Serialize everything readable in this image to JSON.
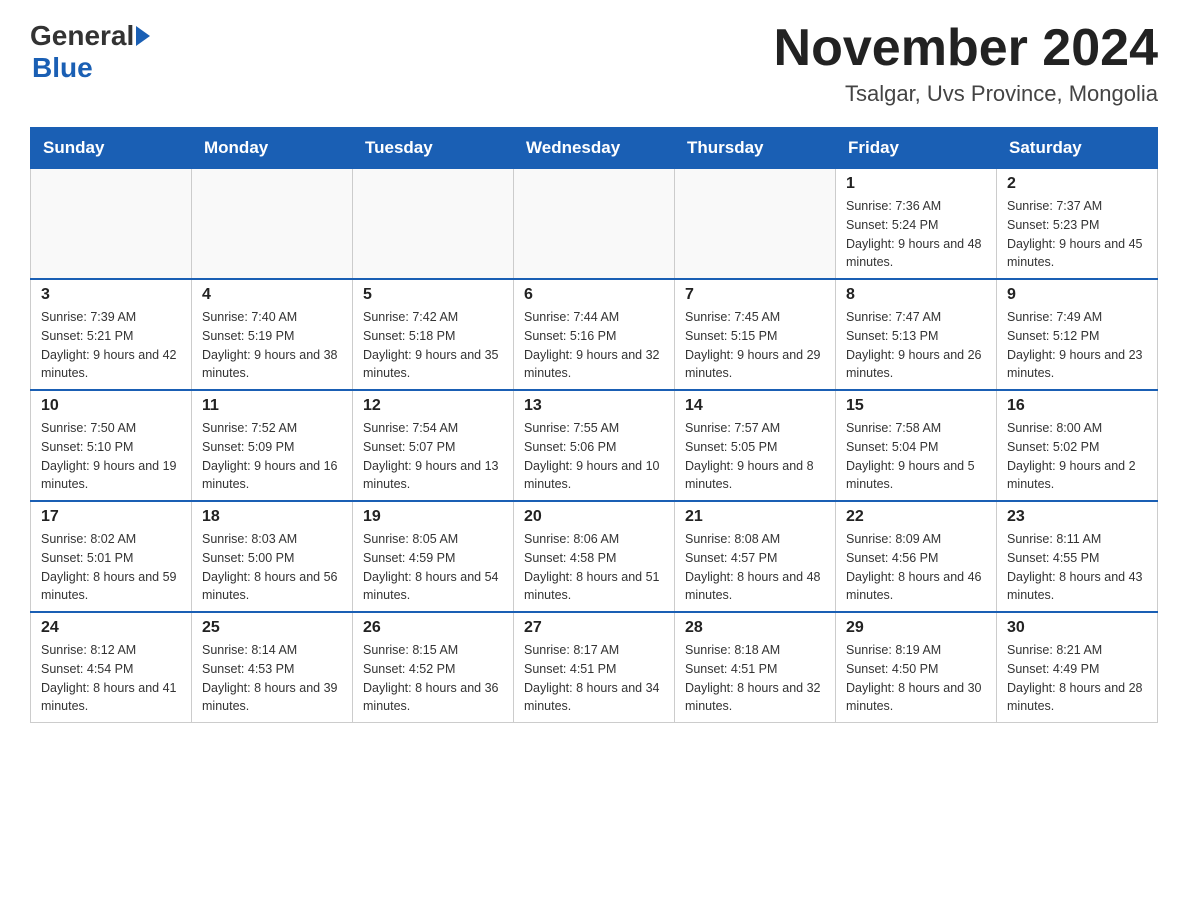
{
  "header": {
    "logo_general": "General",
    "logo_blue": "Blue",
    "month_title": "November 2024",
    "subtitle": "Tsalgar, Uvs Province, Mongolia"
  },
  "days_of_week": [
    "Sunday",
    "Monday",
    "Tuesday",
    "Wednesday",
    "Thursday",
    "Friday",
    "Saturday"
  ],
  "weeks": [
    [
      {
        "day": "",
        "info": ""
      },
      {
        "day": "",
        "info": ""
      },
      {
        "day": "",
        "info": ""
      },
      {
        "day": "",
        "info": ""
      },
      {
        "day": "",
        "info": ""
      },
      {
        "day": "1",
        "info": "Sunrise: 7:36 AM\nSunset: 5:24 PM\nDaylight: 9 hours and 48 minutes."
      },
      {
        "day": "2",
        "info": "Sunrise: 7:37 AM\nSunset: 5:23 PM\nDaylight: 9 hours and 45 minutes."
      }
    ],
    [
      {
        "day": "3",
        "info": "Sunrise: 7:39 AM\nSunset: 5:21 PM\nDaylight: 9 hours and 42 minutes."
      },
      {
        "day": "4",
        "info": "Sunrise: 7:40 AM\nSunset: 5:19 PM\nDaylight: 9 hours and 38 minutes."
      },
      {
        "day": "5",
        "info": "Sunrise: 7:42 AM\nSunset: 5:18 PM\nDaylight: 9 hours and 35 minutes."
      },
      {
        "day": "6",
        "info": "Sunrise: 7:44 AM\nSunset: 5:16 PM\nDaylight: 9 hours and 32 minutes."
      },
      {
        "day": "7",
        "info": "Sunrise: 7:45 AM\nSunset: 5:15 PM\nDaylight: 9 hours and 29 minutes."
      },
      {
        "day": "8",
        "info": "Sunrise: 7:47 AM\nSunset: 5:13 PM\nDaylight: 9 hours and 26 minutes."
      },
      {
        "day": "9",
        "info": "Sunrise: 7:49 AM\nSunset: 5:12 PM\nDaylight: 9 hours and 23 minutes."
      }
    ],
    [
      {
        "day": "10",
        "info": "Sunrise: 7:50 AM\nSunset: 5:10 PM\nDaylight: 9 hours and 19 minutes."
      },
      {
        "day": "11",
        "info": "Sunrise: 7:52 AM\nSunset: 5:09 PM\nDaylight: 9 hours and 16 minutes."
      },
      {
        "day": "12",
        "info": "Sunrise: 7:54 AM\nSunset: 5:07 PM\nDaylight: 9 hours and 13 minutes."
      },
      {
        "day": "13",
        "info": "Sunrise: 7:55 AM\nSunset: 5:06 PM\nDaylight: 9 hours and 10 minutes."
      },
      {
        "day": "14",
        "info": "Sunrise: 7:57 AM\nSunset: 5:05 PM\nDaylight: 9 hours and 8 minutes."
      },
      {
        "day": "15",
        "info": "Sunrise: 7:58 AM\nSunset: 5:04 PM\nDaylight: 9 hours and 5 minutes."
      },
      {
        "day": "16",
        "info": "Sunrise: 8:00 AM\nSunset: 5:02 PM\nDaylight: 9 hours and 2 minutes."
      }
    ],
    [
      {
        "day": "17",
        "info": "Sunrise: 8:02 AM\nSunset: 5:01 PM\nDaylight: 8 hours and 59 minutes."
      },
      {
        "day": "18",
        "info": "Sunrise: 8:03 AM\nSunset: 5:00 PM\nDaylight: 8 hours and 56 minutes."
      },
      {
        "day": "19",
        "info": "Sunrise: 8:05 AM\nSunset: 4:59 PM\nDaylight: 8 hours and 54 minutes."
      },
      {
        "day": "20",
        "info": "Sunrise: 8:06 AM\nSunset: 4:58 PM\nDaylight: 8 hours and 51 minutes."
      },
      {
        "day": "21",
        "info": "Sunrise: 8:08 AM\nSunset: 4:57 PM\nDaylight: 8 hours and 48 minutes."
      },
      {
        "day": "22",
        "info": "Sunrise: 8:09 AM\nSunset: 4:56 PM\nDaylight: 8 hours and 46 minutes."
      },
      {
        "day": "23",
        "info": "Sunrise: 8:11 AM\nSunset: 4:55 PM\nDaylight: 8 hours and 43 minutes."
      }
    ],
    [
      {
        "day": "24",
        "info": "Sunrise: 8:12 AM\nSunset: 4:54 PM\nDaylight: 8 hours and 41 minutes."
      },
      {
        "day": "25",
        "info": "Sunrise: 8:14 AM\nSunset: 4:53 PM\nDaylight: 8 hours and 39 minutes."
      },
      {
        "day": "26",
        "info": "Sunrise: 8:15 AM\nSunset: 4:52 PM\nDaylight: 8 hours and 36 minutes."
      },
      {
        "day": "27",
        "info": "Sunrise: 8:17 AM\nSunset: 4:51 PM\nDaylight: 8 hours and 34 minutes."
      },
      {
        "day": "28",
        "info": "Sunrise: 8:18 AM\nSunset: 4:51 PM\nDaylight: 8 hours and 32 minutes."
      },
      {
        "day": "29",
        "info": "Sunrise: 8:19 AM\nSunset: 4:50 PM\nDaylight: 8 hours and 30 minutes."
      },
      {
        "day": "30",
        "info": "Sunrise: 8:21 AM\nSunset: 4:49 PM\nDaylight: 8 hours and 28 minutes."
      }
    ]
  ]
}
